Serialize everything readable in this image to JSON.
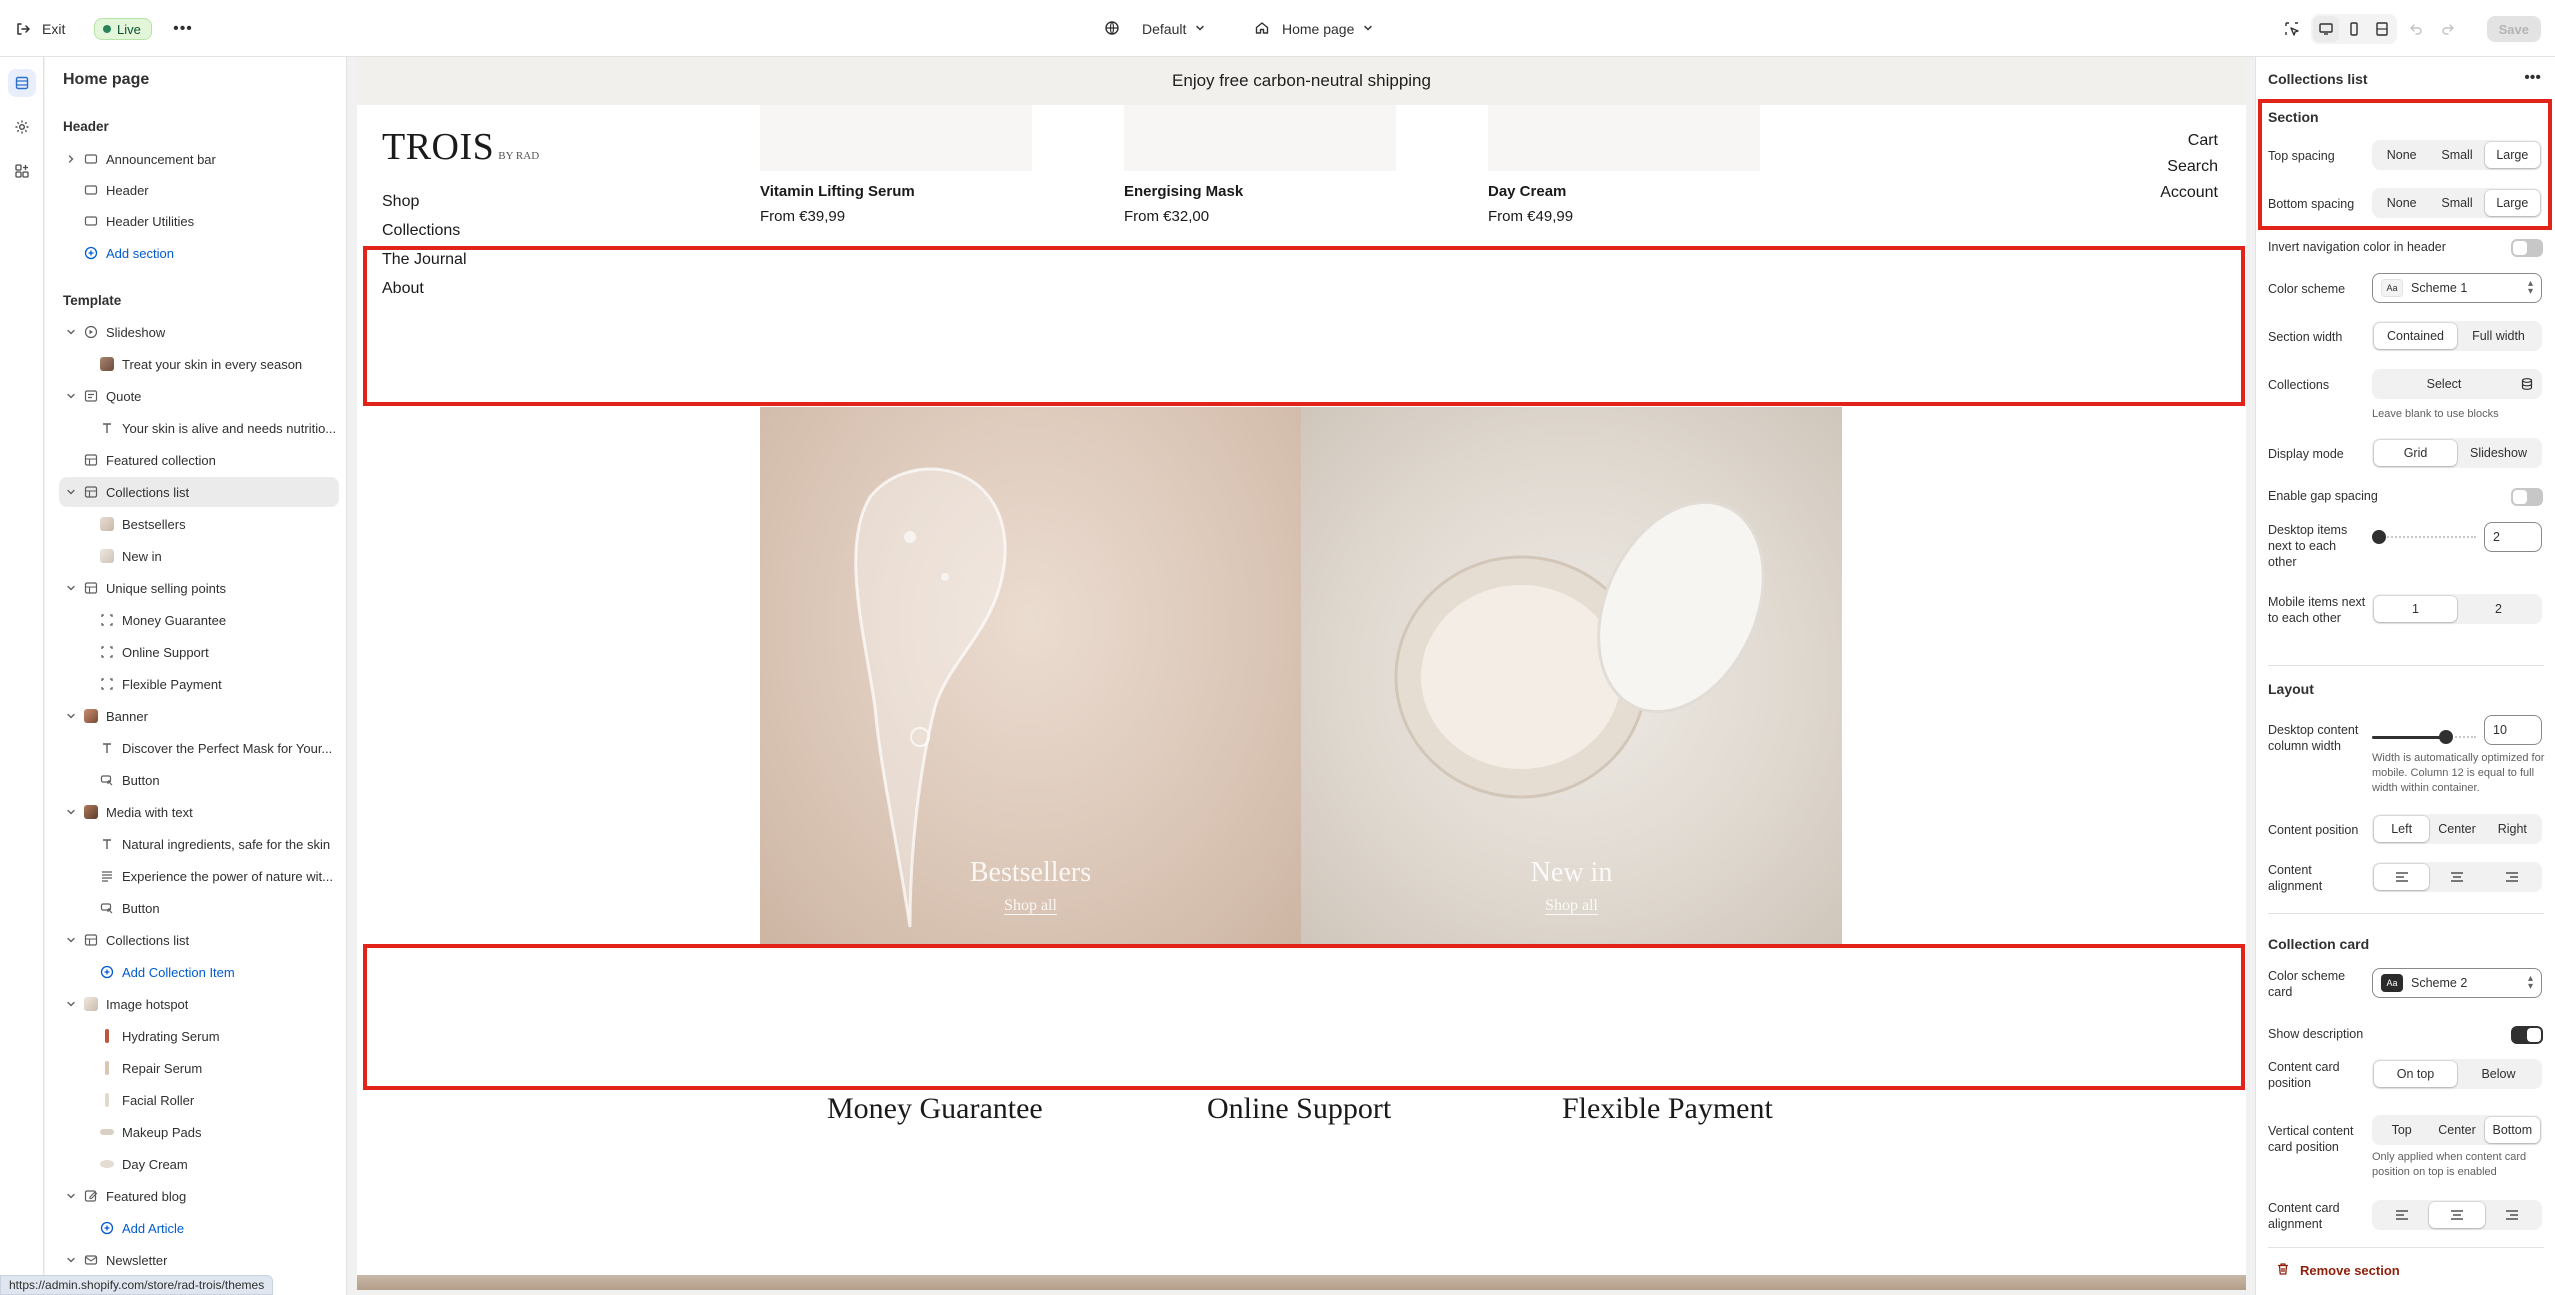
{
  "topbar": {
    "exit_label": "Exit",
    "status_label": "Live",
    "theme_label": "Default",
    "page_label": "Home page",
    "save_label": "Save"
  },
  "tree": {
    "title": "Home page",
    "header_group": "Header",
    "header_items": [
      "Announcement bar",
      "Header",
      "Header Utilities"
    ],
    "add_section": "Add section",
    "template_group": "Template",
    "template_items": [
      "Slideshow",
      "Treat your skin in every season",
      "Quote",
      "Your skin is alive and needs nutritio...",
      "Featured collection",
      "Collections list",
      "Bestsellers",
      "New in",
      "Unique selling points",
      "Money Guarantee",
      "Online Support",
      "Flexible Payment",
      "Banner",
      "Discover the Perfect Mask for Your...",
      "Button",
      "Media with text",
      "Natural ingredients, safe for the skin",
      "Experience the power of nature wit...",
      "Button",
      "Collections list",
      "Add Collection Item",
      "Image hotspot",
      "Hydrating Serum",
      "Repair Serum",
      "Facial Roller",
      "Makeup Pads",
      "Day Cream",
      "Featured blog",
      "Add Article",
      "Newsletter"
    ]
  },
  "status_url": "https://admin.shopify.com/store/rad-trois/themes",
  "preview": {
    "announcement": "Enjoy free carbon-neutral shipping",
    "logo": "TROIS",
    "logo_sub": "BY RAD",
    "nav": [
      "Shop",
      "Collections",
      "The Journal",
      "About"
    ],
    "utility_nav": [
      "Cart",
      "Search",
      "Account"
    ],
    "products": [
      {
        "name": "Vitamin Lifting Serum",
        "price": "From €39,99"
      },
      {
        "name": "Energising Mask",
        "price": "From €32,00"
      },
      {
        "name": "Day Cream",
        "price": "From €49,99"
      }
    ],
    "collections": [
      {
        "title": "Bestsellers",
        "link": "Shop all"
      },
      {
        "title": "New in",
        "link": "Shop all"
      }
    ],
    "usps": [
      "Money Guarantee",
      "Online Support",
      "Flexible Payment"
    ]
  },
  "settings": {
    "title": "Collections list",
    "section_heading": "Section",
    "top_spacing": {
      "label": "Top spacing",
      "options": [
        "None",
        "Small",
        "Large"
      ],
      "selected": "Large"
    },
    "bottom_spacing": {
      "label": "Bottom spacing",
      "options": [
        "None",
        "Small",
        "Large"
      ],
      "selected": "Large"
    },
    "invert_nav": {
      "label": "Invert navigation color in header"
    },
    "color_scheme": {
      "label": "Color scheme",
      "value": "Scheme 1"
    },
    "section_width": {
      "label": "Section width",
      "options": [
        "Contained",
        "Full width"
      ],
      "selected": "Contained"
    },
    "collections": {
      "label": "Collections",
      "button": "Select",
      "hint": "Leave blank to use blocks"
    },
    "display_mode": {
      "label": "Display mode",
      "options": [
        "Grid",
        "Slideshow"
      ],
      "selected": "Grid"
    },
    "gap_spacing": {
      "label": "Enable gap spacing"
    },
    "desktop_items": {
      "label": "Desktop items next to each other",
      "value": "2"
    },
    "mobile_items": {
      "label": "Mobile items next to each other",
      "options": [
        "1",
        "2"
      ],
      "selected": "1"
    },
    "layout_heading": "Layout",
    "content_width": {
      "label": "Desktop content column width",
      "value": "10",
      "hint": "Width is automatically optimized for mobile. Column 12 is equal to full width within container."
    },
    "content_position": {
      "label": "Content position",
      "options": [
        "Left",
        "Center",
        "Right"
      ],
      "selected": "Left"
    },
    "content_alignment": {
      "label": "Content alignment"
    },
    "card_heading": "Collection card",
    "card_scheme": {
      "label": "Color scheme card",
      "value": "Scheme 2"
    },
    "show_description": {
      "label": "Show description"
    },
    "card_position": {
      "label": "Content card position",
      "options": [
        "On top",
        "Below"
      ],
      "selected": "On top"
    },
    "vertical_position": {
      "label": "Vertical content card position",
      "options": [
        "Top",
        "Center",
        "Bottom"
      ],
      "selected": "Bottom",
      "hint": "Only applied when content card position on top is enabled"
    },
    "card_alignment": {
      "label": "Content card alignment"
    },
    "remove_label": "Remove section"
  }
}
